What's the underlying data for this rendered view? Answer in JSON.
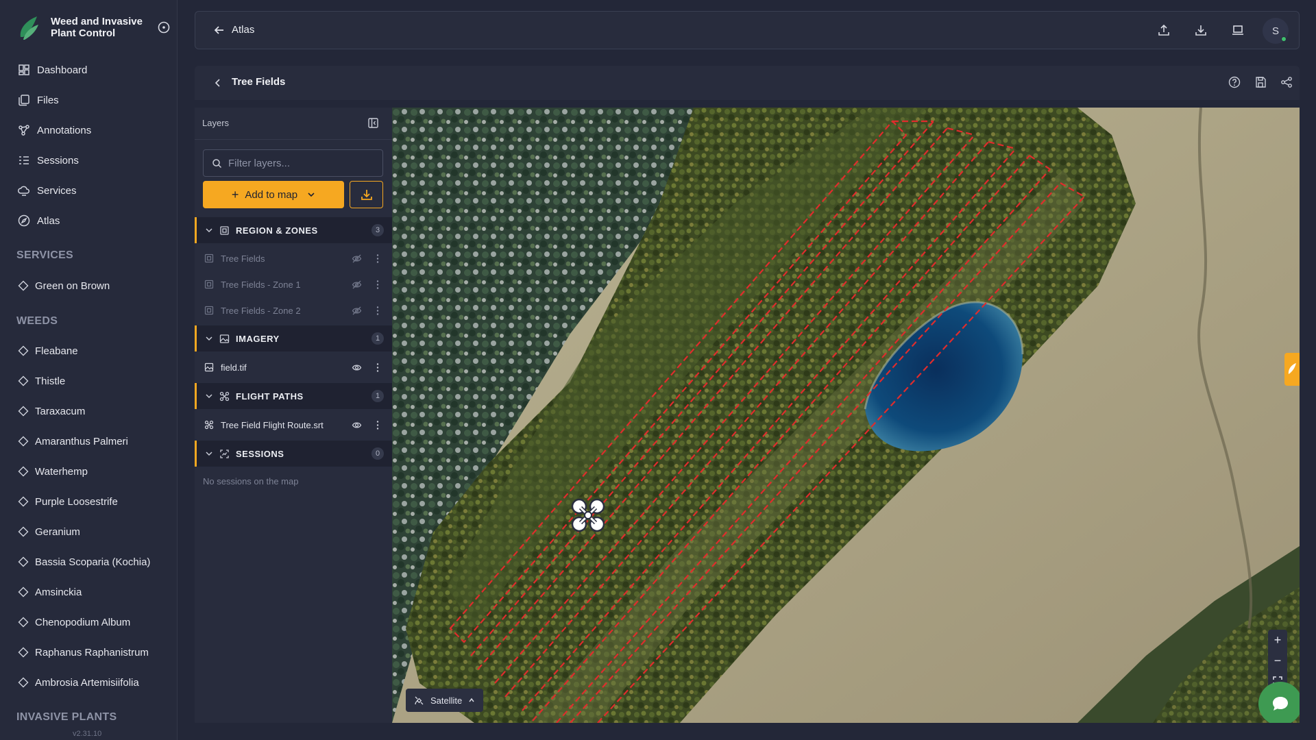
{
  "app": {
    "title": "Weed and Invasive Plant Control",
    "version": "v2.31.10"
  },
  "nav": [
    {
      "label": "Dashboard",
      "icon": "dashboard-icon"
    },
    {
      "label": "Files",
      "icon": "files-icon"
    },
    {
      "label": "Annotations",
      "icon": "annotations-icon"
    },
    {
      "label": "Sessions",
      "icon": "sessions-icon"
    },
    {
      "label": "Services",
      "icon": "services-icon"
    },
    {
      "label": "Atlas",
      "icon": "atlas-icon"
    }
  ],
  "services": {
    "heading": "SERVICES",
    "items": [
      "Green on Brown"
    ]
  },
  "weeds": {
    "heading": "WEEDS",
    "items": [
      "Fleabane",
      "Thistle",
      "Taraxacum",
      "Amaranthus Palmeri",
      "Waterhemp",
      "Purple Loosestrife",
      "Geranium",
      "Bassia Scoparia (Kochia)",
      "Amsinckia",
      "Chenopodium Album",
      "Raphanus Raphanistrum",
      "Ambrosia Artemisiifolia"
    ]
  },
  "invasive": {
    "heading": "INVASIVE PLANTS"
  },
  "topbar": {
    "breadcrumb": "Atlas",
    "avatar_initial": "S"
  },
  "map_header": {
    "title": "Tree Fields"
  },
  "layers": {
    "heading": "Layers",
    "filter_placeholder": "Filter layers...",
    "add_button": "Add to map",
    "groups": [
      {
        "label": "REGION & ZONES",
        "count": "3",
        "items": [
          "Tree Fields",
          "Tree Fields - Zone 1",
          "Tree Fields - Zone 2"
        ]
      },
      {
        "label": "IMAGERY",
        "count": "1",
        "items": [
          "field.tif"
        ]
      },
      {
        "label": "FLIGHT PATHS",
        "count": "1",
        "items": [
          "Tree Field Flight Route.srt"
        ]
      },
      {
        "label": "SESSIONS",
        "count": "0",
        "items": []
      }
    ],
    "empty_sessions": "No sessions on the map"
  },
  "map": {
    "basemap_label": "Satellite",
    "accent_color": "#f6a821",
    "route_color": "#e02c2c"
  }
}
